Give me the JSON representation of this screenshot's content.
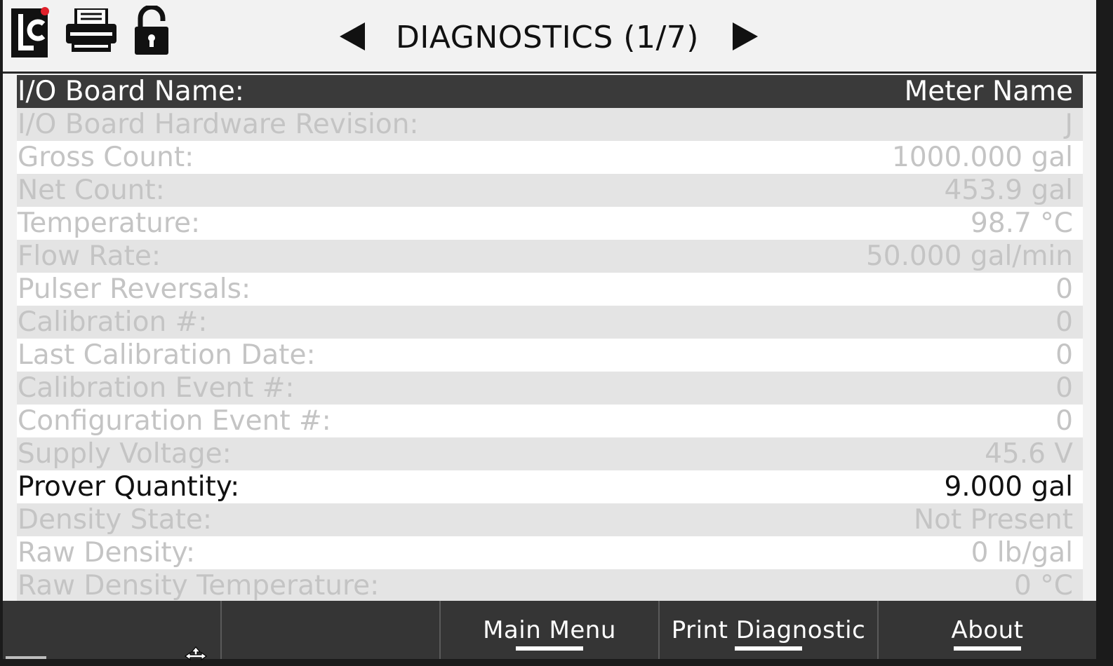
{
  "header": {
    "title": "DIAGNOSTICS (1/7)",
    "icons": [
      "lc-logo-icon",
      "printer-icon",
      "unlock-icon",
      "arrow-left-icon",
      "arrow-right-icon"
    ]
  },
  "rows": [
    {
      "label": "I/O Board Name:",
      "value": "Meter Name",
      "state": "selected"
    },
    {
      "label": "I/O Board Hardware Revision:",
      "value": "J",
      "state": "disabled"
    },
    {
      "label": "Gross Count:",
      "value": "1000.000 gal",
      "state": "disabled"
    },
    {
      "label": "Net Count:",
      "value": "453.9 gal",
      "state": "disabled"
    },
    {
      "label": "Temperature:",
      "value": "98.7 °C",
      "state": "disabled"
    },
    {
      "label": "Flow Rate:",
      "value": "50.000 gal/min",
      "state": "disabled"
    },
    {
      "label": "Pulser Reversals:",
      "value": "0",
      "state": "disabled"
    },
    {
      "label": "Calibration #:",
      "value": "0",
      "state": "disabled"
    },
    {
      "label": "Last Calibration Date:",
      "value": "0",
      "state": "disabled"
    },
    {
      "label": "Calibration Event #:",
      "value": "0",
      "state": "disabled"
    },
    {
      "label": "Configuration Event #:",
      "value": "0",
      "state": "disabled"
    },
    {
      "label": "Supply Voltage:",
      "value": "45.6 V",
      "state": "disabled"
    },
    {
      "label": "Prover Quantity:",
      "value": "9.000 gal",
      "state": "active"
    },
    {
      "label": "Density State:",
      "value": "Not Present",
      "state": "disabled"
    },
    {
      "label": "Raw Density:",
      "value": "0 lb/gal",
      "state": "disabled"
    },
    {
      "label": "Raw Density Temperature:",
      "value": "0 °C",
      "state": "disabled"
    }
  ],
  "footer": {
    "buttons": [
      "",
      "",
      "Main Menu",
      "Print Diagnostic",
      "About"
    ]
  },
  "colors": {
    "selected_row": "#3a3a3a",
    "disabled_text": "#c4c4c4",
    "footer_bg": "#353535"
  }
}
